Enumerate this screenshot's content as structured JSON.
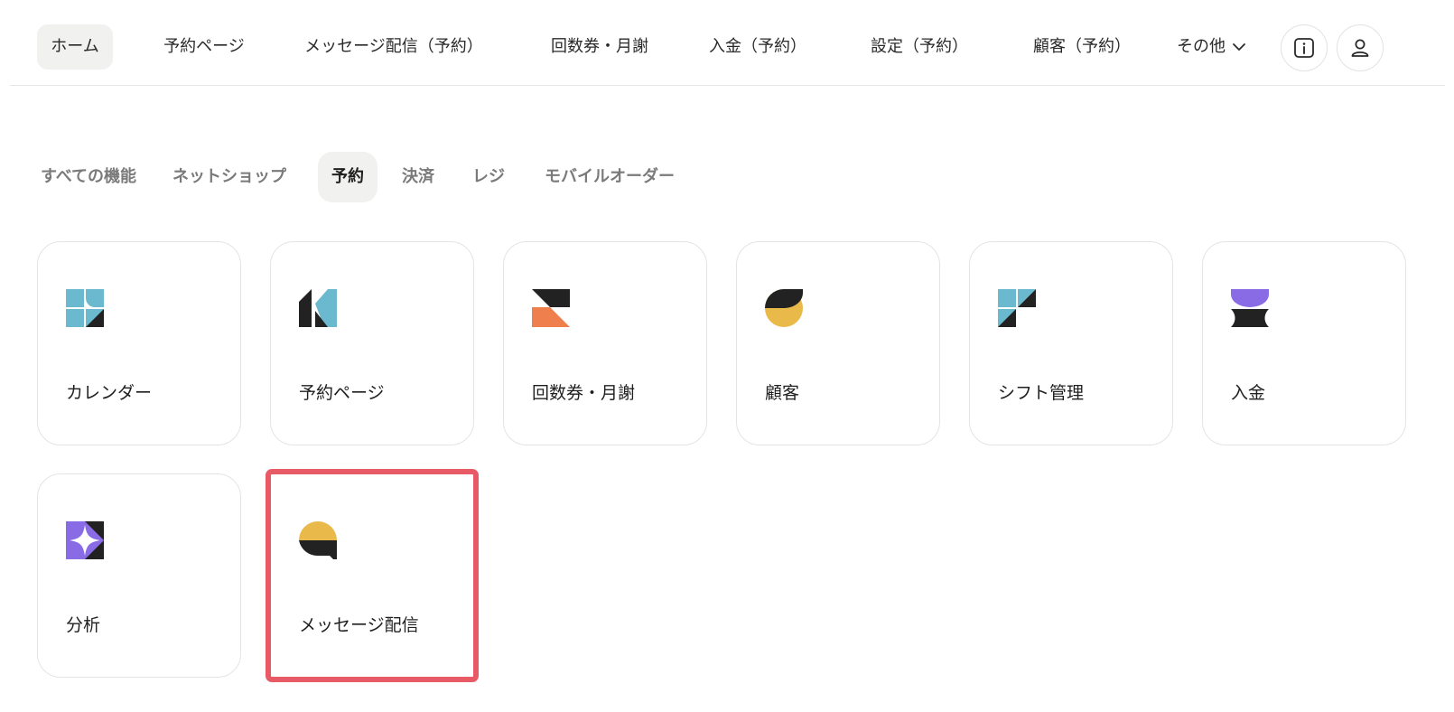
{
  "topnav": {
    "items": [
      {
        "label": "ホーム",
        "active": true
      },
      {
        "label": "予約ページ"
      },
      {
        "label": "メッセージ配信（予約）"
      },
      {
        "label": "回数券・月謝"
      },
      {
        "label": "入金（予約）"
      },
      {
        "label": "設定（予約）"
      },
      {
        "label": "顧客（予約）"
      }
    ],
    "more_label": "その他",
    "info_icon": "info-icon",
    "account_icon": "user-icon"
  },
  "category_tabs": [
    {
      "label": "すべての機能"
    },
    {
      "label": "ネットショップ"
    },
    {
      "label": "予約",
      "active": true
    },
    {
      "label": "決済"
    },
    {
      "label": "レジ"
    },
    {
      "label": "モバイルオーダー"
    }
  ],
  "cards": [
    {
      "label": "カレンダー",
      "icon": "calendar-icon",
      "color": "#6ab9cf"
    },
    {
      "label": "予約ページ",
      "icon": "reservation-page-icon",
      "color": "#6ab9cf"
    },
    {
      "label": "回数券・月謝",
      "icon": "ticket-icon",
      "color": "#f07f4e"
    },
    {
      "label": "顧客",
      "icon": "customer-icon",
      "color": "#e9b94a"
    },
    {
      "label": "シフト管理",
      "icon": "shift-icon",
      "color": "#6ab9cf"
    },
    {
      "label": "入金",
      "icon": "deposit-icon",
      "color": "#8a6be6"
    },
    {
      "label": "分析",
      "icon": "analytics-icon",
      "color": "#8a6be6"
    },
    {
      "label": "メッセージ配信",
      "icon": "message-icon",
      "color": "#e9b94a",
      "highlighted": true
    }
  ],
  "colors": {
    "highlight": "#e85b66",
    "dark": "#222222",
    "blue": "#6ab9cf",
    "orange": "#f07f4e",
    "yellow": "#e9b94a",
    "purple": "#8a6be6"
  }
}
